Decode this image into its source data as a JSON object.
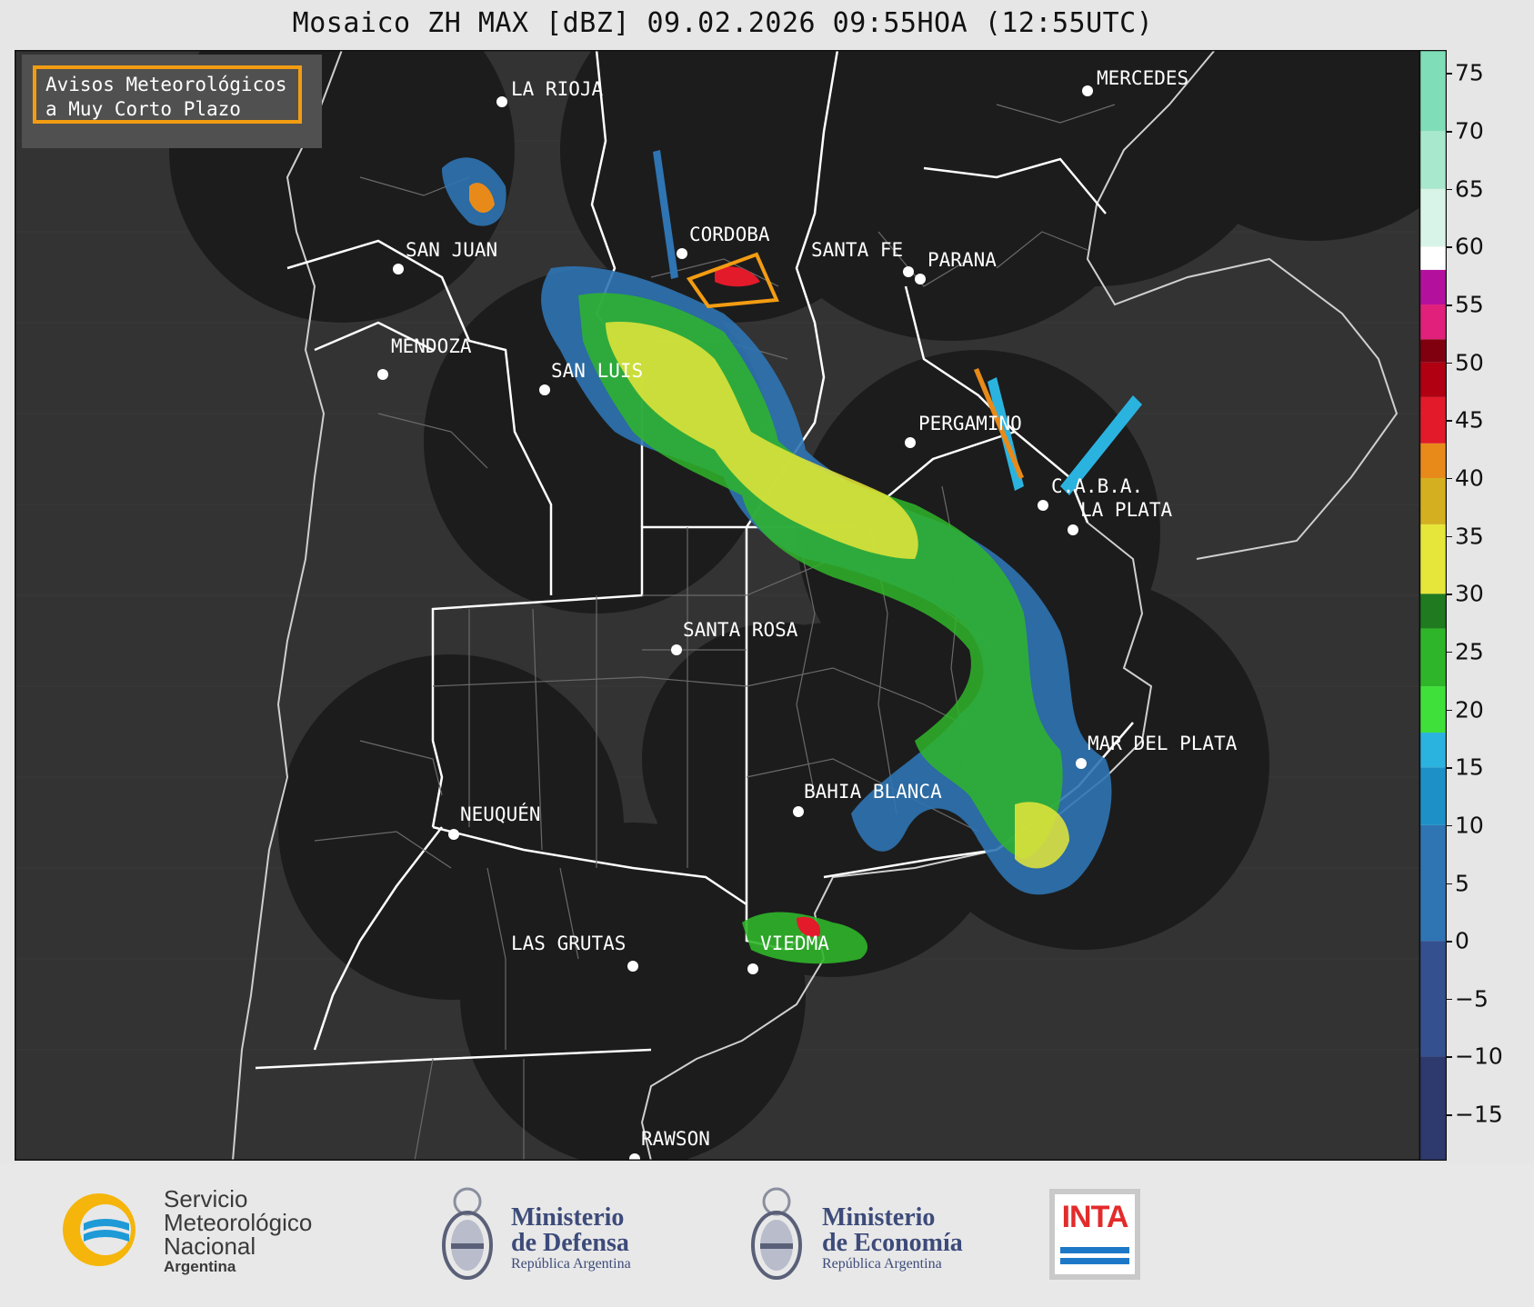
{
  "title": "Mosaico ZH MAX [dBZ] 09.02.2026 09:55HOA (12:55UTC)",
  "avisos": {
    "line1": "Avisos Meteorológicos",
    "line2": "a Muy Corto Plazo"
  },
  "colorbar": {
    "unit": "dBZ",
    "range": [
      -19,
      77
    ],
    "tick_labels": [
      "75",
      "70",
      "65",
      "60",
      "55",
      "50",
      "45",
      "40",
      "35",
      "30",
      "25",
      "20",
      "15",
      "10",
      "5",
      "0",
      "−5",
      "−10",
      "−15"
    ],
    "tick_values": [
      75,
      70,
      65,
      60,
      55,
      50,
      45,
      40,
      35,
      30,
      25,
      20,
      15,
      10,
      5,
      0,
      -5,
      -10,
      -15
    ],
    "stops": [
      {
        "from": -19,
        "to": -10,
        "color": "#2e3a6e"
      },
      {
        "from": -10,
        "to": 0,
        "color": "#34508f"
      },
      {
        "from": 0,
        "to": 10,
        "color": "#2f74b3"
      },
      {
        "from": 10,
        "to": 15,
        "color": "#1e90c8"
      },
      {
        "from": 15,
        "to": 18,
        "color": "#2bb3e0"
      },
      {
        "from": 18,
        "to": 22,
        "color": "#3fe03a"
      },
      {
        "from": 22,
        "to": 27,
        "color": "#2fb52a"
      },
      {
        "from": 27,
        "to": 30,
        "color": "#1f7a20"
      },
      {
        "from": 30,
        "to": 36,
        "color": "#e6e63a"
      },
      {
        "from": 36,
        "to": 40,
        "color": "#d4b020"
      },
      {
        "from": 40,
        "to": 43,
        "color": "#e88a1a"
      },
      {
        "from": 43,
        "to": 47,
        "color": "#e21a2a"
      },
      {
        "from": 47,
        "to": 50,
        "color": "#b00012"
      },
      {
        "from": 50,
        "to": 52,
        "color": "#800010"
      },
      {
        "from": 52,
        "to": 55,
        "color": "#e0207a"
      },
      {
        "from": 55,
        "to": 58,
        "color": "#b4109e"
      },
      {
        "from": 58,
        "to": 60,
        "color": "#ffffff"
      },
      {
        "from": 60,
        "to": 65,
        "color": "#d8f4e8"
      },
      {
        "from": 65,
        "to": 70,
        "color": "#a8e8cc"
      },
      {
        "from": 70,
        "to": 77,
        "color": "#7fddb8"
      }
    ]
  },
  "cities": [
    {
      "name": "LA RIOJA"
    },
    {
      "name": "MERCEDES"
    },
    {
      "name": "CORDOBA"
    },
    {
      "name": "SAN JUAN"
    },
    {
      "name": "SANTA FE"
    },
    {
      "name": "PARANA"
    },
    {
      "name": "MENDOZA"
    },
    {
      "name": "SAN LUIS"
    },
    {
      "name": "PERGAMINO"
    },
    {
      "name": "C.A.B.A."
    },
    {
      "name": "LA PLATA"
    },
    {
      "name": "SANTA ROSA"
    },
    {
      "name": "MAR DEL PLATA"
    },
    {
      "name": "BAHIA BLANCA"
    },
    {
      "name": "NEUQUÉN"
    },
    {
      "name": "LAS GRUTAS"
    },
    {
      "name": "VIEDMA"
    },
    {
      "name": "RAWSON"
    }
  ],
  "footer": {
    "smn": {
      "line1": "Servicio",
      "line2": "Meteorológico",
      "line3": "Nacional",
      "sub": "Argentina"
    },
    "defensa": {
      "line1": "Ministerio",
      "line2": "de Defensa",
      "sub": "República Argentina"
    },
    "economia": {
      "line1": "Ministerio",
      "line2": "de Economía",
      "sub": "República Argentina"
    },
    "inta": {
      "word": "INTA"
    }
  },
  "colors": {
    "map_background": "#333333",
    "radar_coverage": "#1c1c1c",
    "province_borders": "#ffffff",
    "district_lines": "#6a6a6a",
    "warning_box": "#f39c12"
  }
}
